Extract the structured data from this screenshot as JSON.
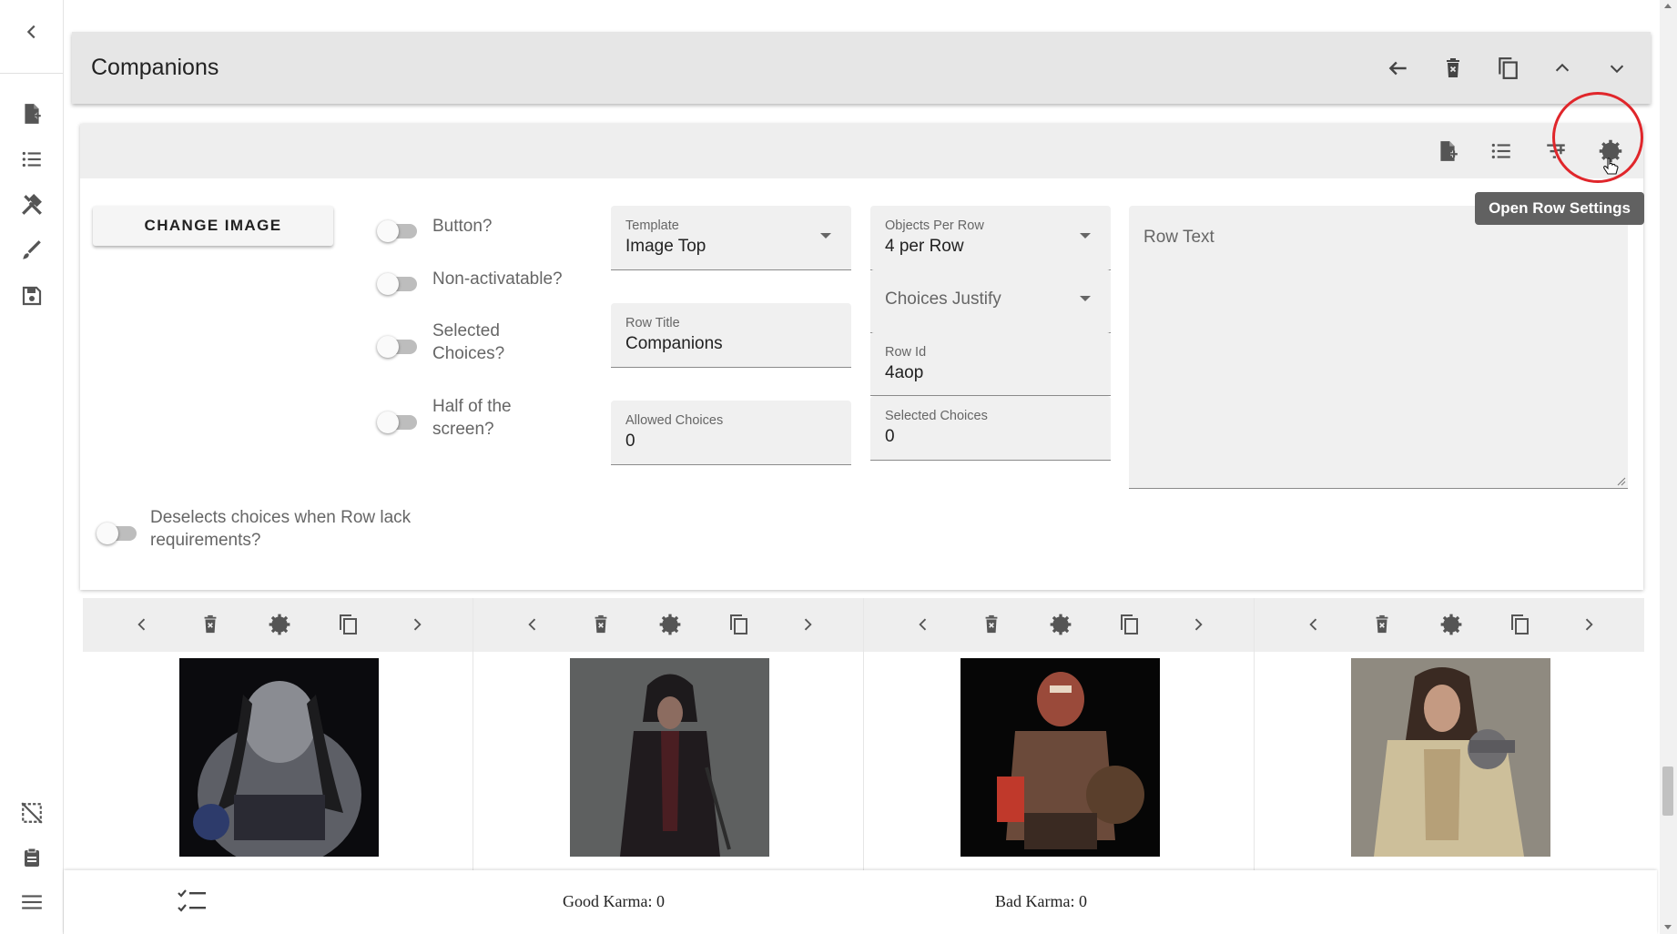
{
  "rail": {
    "icons": [
      "chevron-left-icon",
      "file-plus-icon",
      "list-icon",
      "tools-icon",
      "brush-icon",
      "save-icon",
      "image-off-icon",
      "clipboard-icon",
      "menu-icon"
    ]
  },
  "header": {
    "title": "Companions"
  },
  "settings": {
    "change_image_label": "CHANGE IMAGE",
    "toggles": {
      "button": "Button?",
      "non_activatable": "Non-activatable?",
      "selected_choices_1": "Selected",
      "selected_choices_2": "Choices?",
      "half_screen_1": "Half of the",
      "half_screen_2": "screen?",
      "deselect_1": "Deselects choices when Row lack",
      "deselect_2": "requirements?"
    },
    "template": {
      "label": "Template",
      "value": "Image Top"
    },
    "row_title": {
      "label": "Row Title",
      "value": "Companions"
    },
    "allowed_choices": {
      "label": "Allowed Choices",
      "value": "0"
    },
    "objects_per_row": {
      "label": "Objects Per Row",
      "value": "4 per Row"
    },
    "choices_justify": {
      "placeholder": "Choices Justify"
    },
    "row_id": {
      "label": "Row Id",
      "value": "4aop"
    },
    "selected_choices": {
      "label": "Selected Choices",
      "value": "0"
    },
    "row_text": {
      "placeholder": "Row Text"
    },
    "tooltip": "Open Row Settings"
  },
  "choices": [
    {
      "image": "dark-brute-portrait"
    },
    {
      "image": "hooded-rogue-portrait"
    },
    {
      "image": "armored-gladiator-portrait"
    },
    {
      "image": "fur-coat-woman-portrait"
    }
  ],
  "footer": {
    "good_karma": "Good Karma: 0",
    "bad_karma": "Bad Karma: 0"
  },
  "colors": {
    "highlight_circle": "#e0262b",
    "tooltip_bg": "#616161",
    "toolbar_bg": "#eeeeee"
  }
}
